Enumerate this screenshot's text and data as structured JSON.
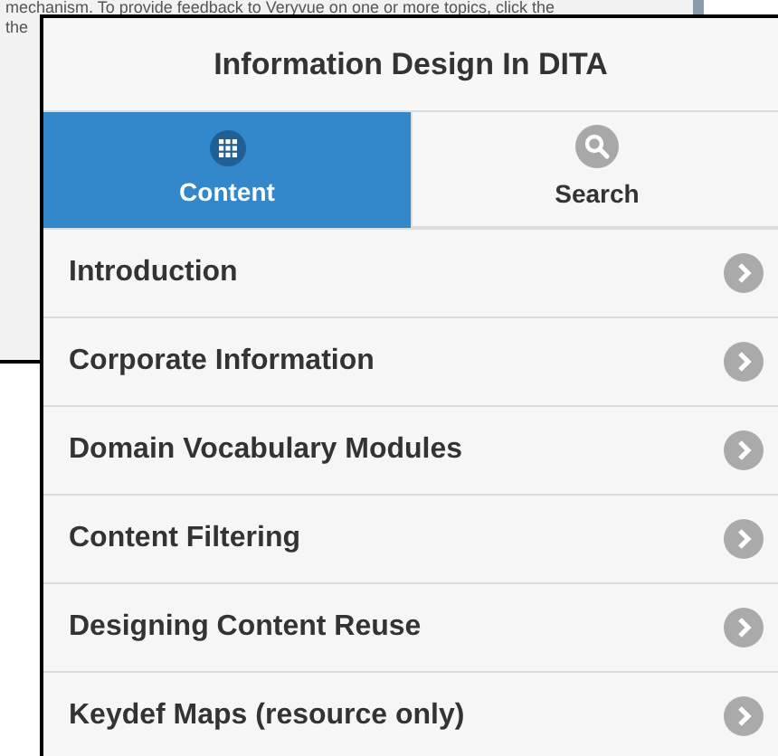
{
  "background_page": {
    "lines": [
      "mechanism. To provide feedback to Veryvue on one or more topics, click the",
      "the"
    ]
  },
  "panel": {
    "title": "Information Design In DITA",
    "tabs": [
      {
        "label": "Content",
        "kind": "grid",
        "selected": true
      },
      {
        "label": "Search",
        "kind": "search",
        "selected": false
      }
    ],
    "items": [
      {
        "label": "Introduction"
      },
      {
        "label": "Corporate Information"
      },
      {
        "label": "Domain Vocabulary Modules"
      },
      {
        "label": "Content Filtering"
      },
      {
        "label": "Designing Content Reuse"
      },
      {
        "label": "Keydef Maps (resource only)"
      }
    ]
  }
}
